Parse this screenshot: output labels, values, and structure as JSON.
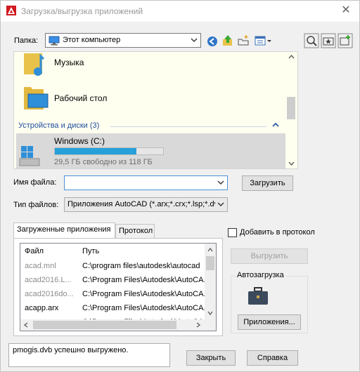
{
  "window": {
    "title": "Загрузка/выгрузка приложений",
    "close": "✕"
  },
  "folder": {
    "label": "Папка:",
    "value": "Этот компьютер"
  },
  "file_pane": {
    "items": [
      {
        "label": "Музыка",
        "icon": "music-folder-icon"
      },
      {
        "label": "Рабочий стол",
        "icon": "desktop-folder-icon"
      }
    ],
    "section_header": "Устройства и диски (3)",
    "drive": {
      "name": "Windows (C:)",
      "free_text": "29,5 ГБ свободно из 118 ГБ",
      "used_fraction": 0.75
    }
  },
  "filename": {
    "label": "Имя файла:",
    "value": "",
    "load_button": "Загрузить"
  },
  "filetype": {
    "label": "Тип файлов:",
    "value": "Приложения AutoCAD (*.arx;*.crx;*.lsp;*.dvb"
  },
  "tabs": [
    "Загруженные приложения",
    "Протокол"
  ],
  "add_to_history": "Добавить в протокол",
  "apps_list": {
    "headers": [
      "Файл",
      "Путь"
    ],
    "rows": [
      {
        "file": "acad.mnl",
        "path": "C:\\program files\\autodesk\\autocad",
        "gray": true
      },
      {
        "file": "acad2016.L...",
        "path": "C:\\Program Files\\Autodesk\\AutoCA...",
        "gray": true
      },
      {
        "file": "acad2016do...",
        "path": "C:\\Program Files\\Autodesk\\AutoCA...",
        "gray": true
      },
      {
        "file": "acapp.arx",
        "path": "C:\\Program Files\\Autodesk\\AutoCA...",
        "gray": false
      },
      {
        "file": "",
        "path": "C:\\Program Files\\Autodesk\\AutoCA...",
        "gray": false
      }
    ]
  },
  "unload_button": "Выгрузить",
  "startup": {
    "title": "Автозагрузка",
    "button": "Приложения..."
  },
  "status_text": "pmogis.dvb успешно выгружено.",
  "close_button": "Закрыть",
  "help_button": "Справка",
  "colors": {
    "accent": "#2e6ec7",
    "progress": "#26a0da",
    "selected": "#d9d9d9",
    "pane_bg": "#fffff0"
  }
}
